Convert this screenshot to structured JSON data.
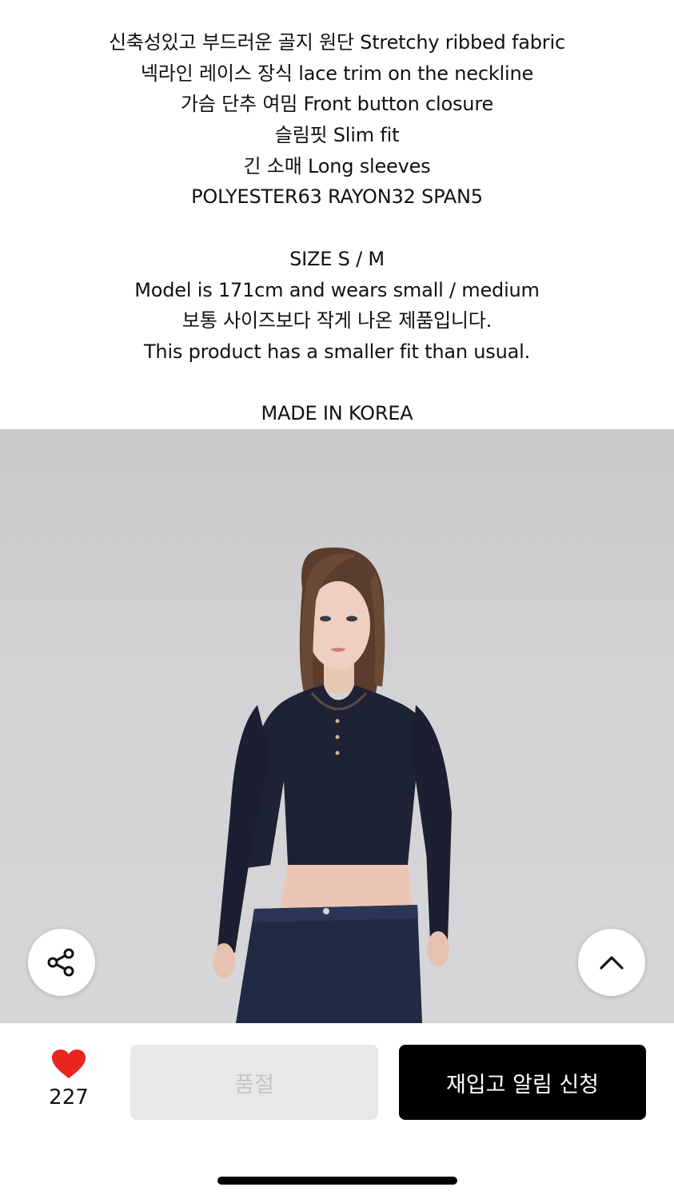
{
  "description": {
    "lines": [
      "신축성있고 부드러운 골지 원단 Stretchy ribbed fabric",
      "넥라인 레이스 장식 lace trim on the neckline",
      "가슴 단추 여밈 Front button closure",
      "슬림핏 Slim fit",
      "긴 소매 Long sleeves",
      "POLYESTER63 RAYON32 SPAN5"
    ],
    "size_lines": [
      "SIZE S / M",
      "Model is 171cm and wears small / medium",
      "보통 사이즈보다 작게 나온 제품입니다.",
      "This product has a smaller fit than usual."
    ],
    "origin": "MADE IN KOREA"
  },
  "product_image": {
    "alt": ""
  },
  "floating": {
    "share_icon": "share-icon",
    "top_icon": "chevron-up-icon"
  },
  "bottom_bar": {
    "like_count": "227",
    "like_color": "#e8261f",
    "soldout_label": "품절",
    "restock_label": "재입고 알림 신청"
  }
}
